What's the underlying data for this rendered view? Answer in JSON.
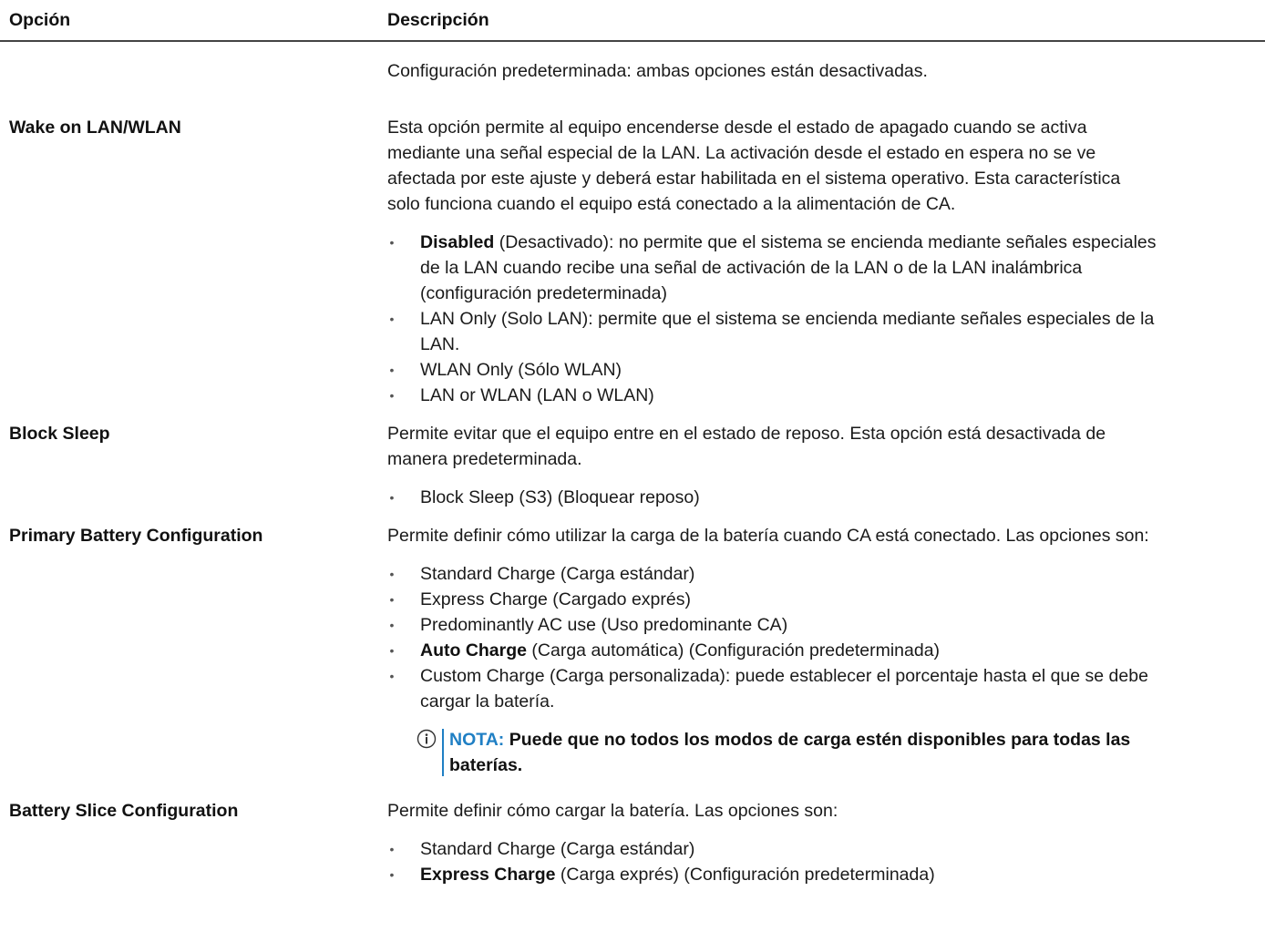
{
  "header": {
    "option": "Opción",
    "description": "Descripción"
  },
  "rows": [
    {
      "option": "",
      "paragraphs": [
        "Configuración predeterminada: ambas opciones están desactivadas."
      ]
    },
    {
      "option": "Wake on LAN/WLAN",
      "paragraphs": [
        "Esta opción permite al equipo encenderse desde el estado de apagado cuando se activa",
        "mediante una señal especial de la LAN. La activación desde el estado en espera no se ve",
        "afectada por este ajuste y deberá estar habilitada en el sistema operativo. Esta característica",
        "solo funciona cuando el equipo está conectado a la alimentación de CA."
      ],
      "bullets": [
        {
          "bold": "Disabled",
          "lines": [
            " (Desactivado): no permite que el sistema se encienda mediante señales especiales",
            "de la LAN cuando recibe una señal de activación de la LAN o de la LAN inalámbrica",
            "(configuración predeterminada)"
          ]
        },
        {
          "bold": "",
          "lines": [
            "LAN Only (Solo LAN): permite que el sistema se encienda mediante señales especiales de la",
            "LAN."
          ]
        },
        {
          "bold": "",
          "lines": [
            "WLAN Only (Sólo WLAN)"
          ]
        },
        {
          "bold": "",
          "lines": [
            "LAN or WLAN (LAN o WLAN)"
          ]
        }
      ]
    },
    {
      "option": "Block Sleep",
      "paragraphs": [
        "Permite evitar que el equipo entre en el estado de reposo. Esta opción está desactivada de",
        "manera predeterminada."
      ],
      "bullets": [
        {
          "bold": "",
          "lines": [
            "Block Sleep (S3) (Bloquear reposo)"
          ]
        }
      ]
    },
    {
      "option": "Primary Battery Configuration",
      "paragraphs": [
        "Permite definir cómo utilizar la carga de la batería cuando CA está conectado. Las opciones son:"
      ],
      "bullets": [
        {
          "bold": "",
          "lines": [
            "Standard Charge (Carga estándar)"
          ]
        },
        {
          "bold": "",
          "lines": [
            "Express Charge (Cargado exprés)"
          ]
        },
        {
          "bold": "",
          "lines": [
            "Predominantly AC use (Uso predominante CA)"
          ]
        },
        {
          "bold": "Auto Charge",
          "lines": [
            " (Carga automática) (Configuración predeterminada)"
          ]
        },
        {
          "bold": "",
          "lines": [
            "Custom Charge (Carga personalizada): puede establecer el porcentaje hasta el que se debe",
            "cargar la batería."
          ]
        }
      ],
      "note": {
        "label": "NOTA:",
        "lines": [
          " Puede que no todos los modos de carga estén disponibles para todas las",
          "baterías."
        ]
      }
    },
    {
      "option": "Battery Slice Configuration",
      "paragraphs": [
        "Permite definir cómo cargar la batería. Las opciones son:"
      ],
      "bullets": [
        {
          "bold": "",
          "lines": [
            "Standard Charge (Carga estándar)"
          ]
        },
        {
          "bold": "Express Charge",
          "lines": [
            " (Carga exprés) (Configuración predeterminada)"
          ]
        }
      ]
    }
  ],
  "icons": {
    "bullet": "bullet-dot",
    "note": "info-icon"
  },
  "colors": {
    "note_accent": "#1f7fc4"
  }
}
